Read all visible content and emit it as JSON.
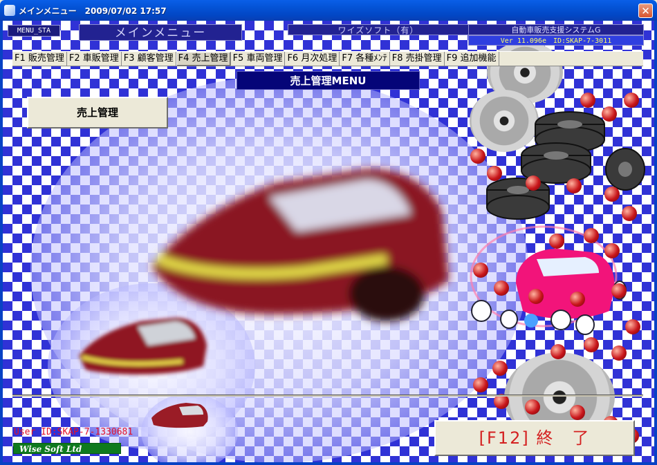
{
  "window": {
    "title": "メインメニュー　2009/07/02 17:57",
    "close_glyph": "✕"
  },
  "header": {
    "menu_code": "MENU_STA",
    "main_title": "メインメニュー",
    "company": "ワイズソフト（有）",
    "system_name": "自動車販売支援システムG",
    "version": "Ver 11.096e　ID:SKAP-7-3011"
  },
  "tabs": [
    {
      "label": "F1 販売管理"
    },
    {
      "label": "F2 車販管理"
    },
    {
      "label": "F3 顧客管理"
    },
    {
      "label": "F4 売上管理",
      "active": true
    },
    {
      "label": "F5 車両管理"
    },
    {
      "label": "F6 月次処理"
    },
    {
      "label": "F7 各種ﾒﾝﾃ"
    },
    {
      "label": "F8 売掛管理"
    },
    {
      "label": "F9 追加機能"
    }
  ],
  "main": {
    "menu_header": "売上管理MENU",
    "sales_button": "売上管理",
    "exit_button": "[F12] 終　了"
  },
  "footer": {
    "user_id": "User ID:SKAP-7-1330681",
    "brand": "Wise Soft Ltd"
  },
  "colors": {
    "checker": "#3032d6",
    "title_bar": "#0453d6",
    "exit_text": "#d42020",
    "user_id": "#e3122a",
    "brand_bg": "#0e7a1e"
  },
  "icons": [
    "app-icon",
    "close-icon",
    "gear-icon",
    "tire-icon"
  ]
}
